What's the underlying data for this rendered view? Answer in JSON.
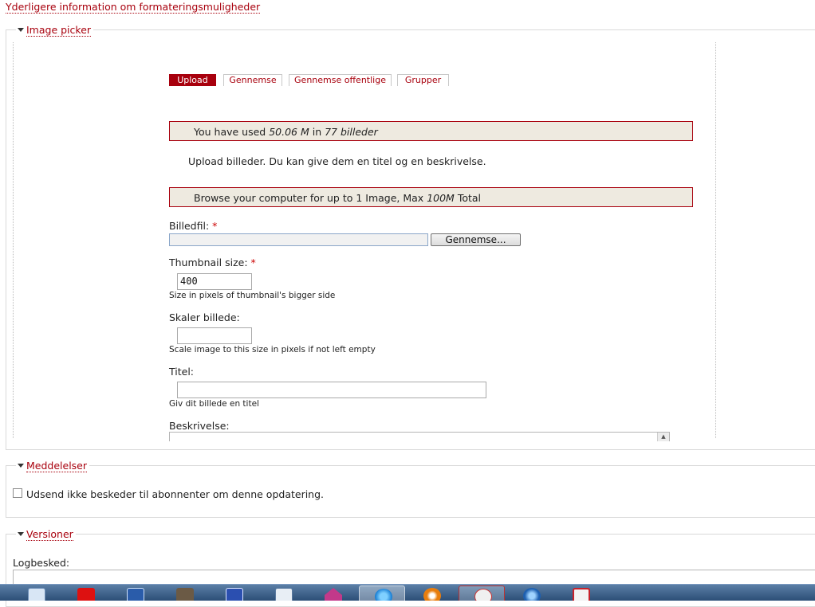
{
  "top_link": "Yderligere information om formateringsmuligheder",
  "image_picker": {
    "legend": "Image picker",
    "tabs": [
      "Upload",
      "Gennemse",
      "Gennemse offentlige",
      "Grupper"
    ],
    "usage": {
      "prefix": "You have used ",
      "size": "50.06 M",
      "mid": " in ",
      "count": "77 billeder"
    },
    "intro": "Upload billeder. Du kan give dem en titel og en beskrivelse.",
    "browse_info": {
      "prefix": "Browse your computer for up to 1 Image, Max ",
      "max": "100M",
      "suffix": " Total"
    },
    "file_label": "Billedfil:",
    "file_value": "",
    "browse_button": "Gennemse...",
    "thumb_label": "Thumbnail size:",
    "thumb_value": "400",
    "thumb_desc": "Size in pixels of thumbnail's bigger side",
    "scale_label": "Skaler billede:",
    "scale_value": "",
    "scale_desc": "Scale image to this size in pixels if not left empty",
    "title_label": "Titel:",
    "title_value": "",
    "title_desc": "Giv dit billede en titel",
    "desc_label": "Beskrivelse:",
    "required_mark": "*"
  },
  "meddelelser": {
    "legend": "Meddelelser",
    "checkbox_label": "Udsend ikke beskeder til abonnenter om denne opdatering.",
    "checked": false
  },
  "versioner": {
    "legend": "Versioner",
    "log_label": "Logbesked:"
  },
  "taskbar": {
    "icons": [
      "outlook-icon",
      "app-td-icon",
      "word-icon",
      "gimp-icon",
      "control-panel-icon",
      "network-icon",
      "house-icon",
      "internet-explorer-icon",
      "blender-icon",
      "app-tools-icon",
      "media-icon",
      "paint-icon"
    ]
  },
  "colors": {
    "accent": "#a8000d",
    "message_bg": "#eeeae0"
  }
}
